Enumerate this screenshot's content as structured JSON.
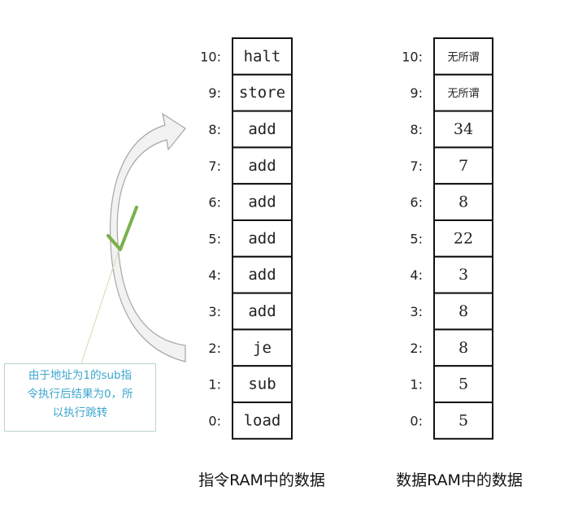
{
  "instruction_ram": {
    "caption": "指令RAM中的数据",
    "cells": [
      {
        "address": "10:",
        "value": "halt"
      },
      {
        "address": "9:",
        "value": "store"
      },
      {
        "address": "8:",
        "value": "add"
      },
      {
        "address": "7:",
        "value": "add"
      },
      {
        "address": "6:",
        "value": "add"
      },
      {
        "address": "5:",
        "value": "add"
      },
      {
        "address": "4:",
        "value": "add"
      },
      {
        "address": "3:",
        "value": "add"
      },
      {
        "address": "2:",
        "value": "je"
      },
      {
        "address": "1:",
        "value": "sub"
      },
      {
        "address": "0:",
        "value": "load"
      }
    ]
  },
  "data_ram": {
    "caption": "数据RAM中的数据",
    "cells": [
      {
        "address": "10:",
        "value": "无所谓"
      },
      {
        "address": "9:",
        "value": "无所谓"
      },
      {
        "address": "8:",
        "value": "34"
      },
      {
        "address": "7:",
        "value": "7"
      },
      {
        "address": "6:",
        "value": "8"
      },
      {
        "address": "5:",
        "value": "22"
      },
      {
        "address": "4:",
        "value": "3"
      },
      {
        "address": "3:",
        "value": "8"
      },
      {
        "address": "2:",
        "value": "8"
      },
      {
        "address": "1:",
        "value": "5"
      },
      {
        "address": "0:",
        "value": "5"
      }
    ]
  },
  "annotation": {
    "note": "由于地址为1的sub指令执行后结果为0，所以执行跳转",
    "note_lines": [
      "由于地址为1的sub指",
      "令执行后结果为0，所",
      "以执行跳转"
    ],
    "text_color": "#3ba6cf",
    "check_color": "#7bb04a",
    "arrow_fill": "#f2f2f2",
    "arrow_stroke": "#a6a6a6"
  }
}
